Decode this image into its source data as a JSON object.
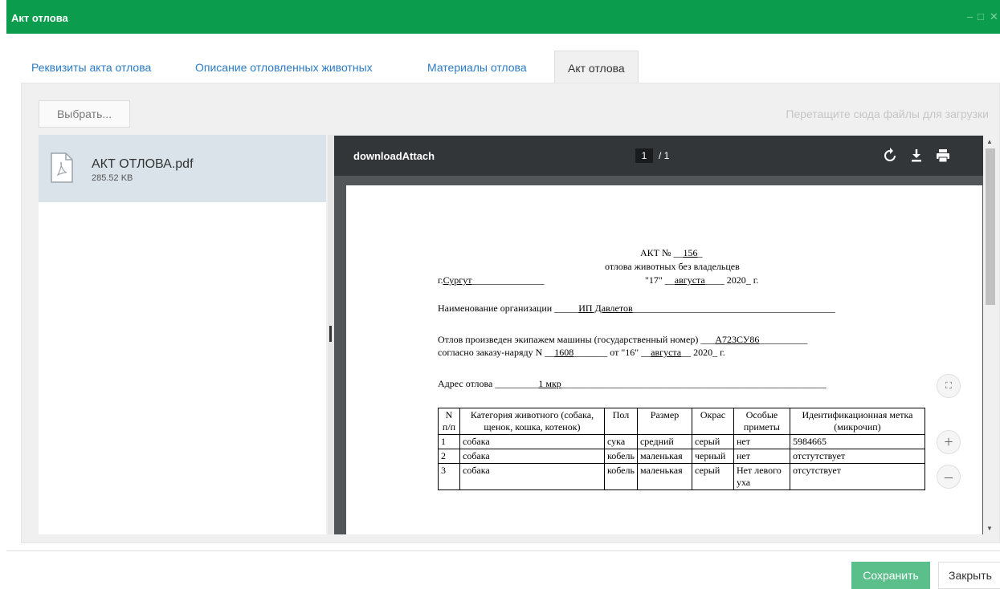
{
  "window": {
    "title": "Акт отлова",
    "controls": {
      "minimize": "–",
      "maximize": "□",
      "close": "✕"
    },
    "accent_color": "#0c9c4e"
  },
  "tabs": [
    {
      "label": "Реквизиты акта отлова",
      "active": false
    },
    {
      "label": "Описание отловленных животных",
      "active": false
    },
    {
      "label": "Материалы отлова",
      "active": false
    },
    {
      "label": "Акт отлова",
      "active": true
    }
  ],
  "uploader": {
    "select_label": "Выбрать...",
    "drop_hint": "Перетащите сюда файлы для загрузки"
  },
  "files": [
    {
      "name": "АКТ ОТЛОВА.pdf",
      "size": "285.52 KB",
      "icon": "pdf-file-icon"
    }
  ],
  "viewer": {
    "doc_title": "downloadAttach",
    "page_current": "1",
    "page_total": "/ 1",
    "icons": [
      "rotate-icon",
      "download-icon",
      "print-icon"
    ],
    "zoom_fit": "⛶",
    "zoom_in": "+",
    "zoom_out": "–"
  },
  "document": {
    "title_prefix": "АКТ №",
    "title_number": "156",
    "subtitle": "отлова животных без владельцев",
    "city_prefix": "г.",
    "city": "Сургут",
    "date_day": "\"17\"",
    "date_month": "августа",
    "date_year": "2020_ г.",
    "org_label": "Наименование организации",
    "org_value": "ИП Давлетов",
    "crew_label": "Отлов произведен экипажем машины (государственный номер)",
    "crew_value": "А723СУ86",
    "order_label": "согласно заказу-наряду N",
    "order_number": "1608",
    "order_from": "от \"16\"",
    "order_month": "августа",
    "order_year": "2020_ г.",
    "address_label": "Адрес отлова",
    "address_value": "1 мкр",
    "table_headers": [
      "N п/п",
      "Категория животного (собака, щенок, кошка, котенок)",
      "Пол",
      "Размер",
      "Окрас",
      "Особые приметы",
      "Идентификационная метка (микрочип)"
    ],
    "table_rows": [
      [
        "1",
        "собака",
        "сука",
        "средний",
        "серый",
        "нет",
        "5984665"
      ],
      [
        "2",
        "собака",
        "кобель",
        "маленькая",
        "черный",
        "нет",
        "отстутствует"
      ],
      [
        "3",
        "собака",
        "кобель",
        "маленькая",
        "серый",
        "Нет левого уха",
        "отсутствует"
      ]
    ]
  },
  "footer": {
    "save_label": "Сохранить",
    "close_label": "Закрыть",
    "save_color": "#5bbf8c"
  }
}
